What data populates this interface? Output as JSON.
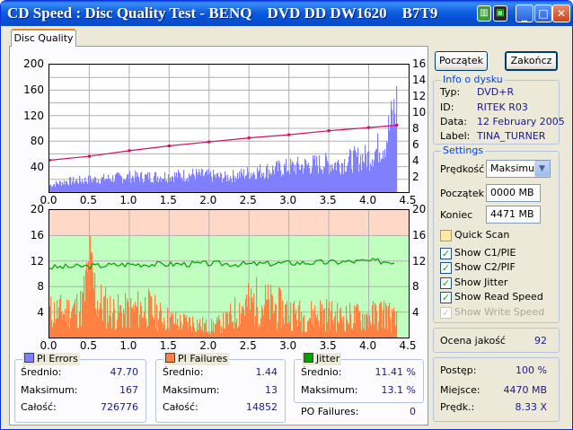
{
  "window": {
    "title": "CD Speed : Disc Quality Test - BENQ    DVD DD DW1620    B7T9",
    "icons": [
      "app-icon-1",
      "app-icon-2",
      "minimize-icon",
      "maximize-icon",
      "close-icon"
    ]
  },
  "tab": {
    "label": "Disc Quality"
  },
  "top_chart_axes": {
    "left_ticks": [
      "200",
      "160",
      "120",
      "80",
      "40"
    ],
    "right_ticks": [
      "16",
      "14",
      "12",
      "10",
      "8",
      "6",
      "4",
      "2"
    ],
    "x_ticks": [
      "0.0",
      "0.5",
      "1.0",
      "1.5",
      "2.0",
      "2.5",
      "3.0",
      "3.5",
      "4.0",
      "4.5"
    ]
  },
  "bottom_chart_axes": {
    "left_ticks": [
      "20",
      "16",
      "12",
      "8",
      "4"
    ],
    "right_ticks": [
      "20",
      "16",
      "12",
      "8",
      "4"
    ],
    "x_ticks": [
      "0.0",
      "0.5",
      "1.0",
      "1.5",
      "2.0",
      "2.5",
      "3.0",
      "3.5",
      "4.0",
      "4.5"
    ]
  },
  "chart_data": [
    {
      "type": "bar",
      "series": [
        {
          "name": "PI Errors",
          "color": "#8080ff",
          "x": [
            0.0,
            0.2,
            0.4,
            0.6,
            0.8,
            1.0,
            1.2,
            1.4,
            1.6,
            1.8,
            2.0,
            2.2,
            2.4,
            2.6,
            2.8,
            3.0,
            3.2,
            3.4,
            3.6,
            3.8,
            4.0,
            4.2,
            4.35
          ],
          "values": [
            12,
            18,
            20,
            22,
            24,
            26,
            26,
            27,
            28,
            30,
            28,
            25,
            30,
            35,
            38,
            42,
            45,
            48,
            48,
            55,
            60,
            85,
            150
          ]
        },
        {
          "name": "Read Speed",
          "color": "#d01060",
          "x": [
            0.0,
            0.5,
            1.0,
            1.5,
            2.0,
            2.5,
            3.0,
            3.5,
            4.0,
            4.35
          ],
          "values": [
            4.0,
            4.5,
            5.2,
            5.8,
            6.3,
            6.8,
            7.2,
            7.7,
            8.1,
            8.4
          ]
        }
      ],
      "xlim": [
        0,
        4.5
      ],
      "ylim": [
        0,
        200
      ],
      "y2lim": [
        0,
        16
      ]
    },
    {
      "type": "bar",
      "series": [
        {
          "name": "PI Failures",
          "color": "#ff8040",
          "x": [
            0.0,
            0.2,
            0.4,
            0.5,
            0.6,
            0.8,
            1.0,
            1.2,
            1.4,
            1.6,
            1.8,
            2.0,
            2.2,
            2.4,
            2.6,
            2.8,
            3.0,
            3.2,
            3.4,
            3.6,
            3.8,
            4.0,
            4.2,
            4.35
          ],
          "values": [
            5,
            5,
            6,
            13,
            7,
            5,
            5,
            6,
            4,
            3,
            3,
            2,
            3,
            6,
            7,
            6,
            5,
            4,
            5,
            4,
            4,
            4,
            5,
            3
          ]
        },
        {
          "name": "Jitter",
          "color": "#00a000",
          "x": [
            0.0,
            0.5,
            1.0,
            1.5,
            2.0,
            2.5,
            3.0,
            3.5,
            4.0,
            4.35
          ],
          "values": [
            11.0,
            11.2,
            11.5,
            11.5,
            11.6,
            11.5,
            11.7,
            11.8,
            12.0,
            11.9
          ]
        }
      ],
      "xlim": [
        0,
        4.5
      ],
      "ylim": [
        0,
        20
      ],
      "y2lim": [
        0,
        20
      ]
    }
  ],
  "pi_errors": {
    "title": "PI Errors",
    "color": "#8080ff",
    "avg_label": "Średnio:",
    "avg": "47.70",
    "max_label": "Maksimum:",
    "max": "167",
    "total_label": "Całość:",
    "total": "726776"
  },
  "pi_failures": {
    "title": "PI Failures",
    "color": "#ff8040",
    "avg_label": "Średnio:",
    "avg": "1.44",
    "max_label": "Maksimum:",
    "max": "13",
    "total_label": "Całość:",
    "total": "14852"
  },
  "jitter": {
    "title": "Jitter",
    "color": "#00a000",
    "avg_label": "Średnio:",
    "avg": "11.41 %",
    "max_label": "Maksimum:",
    "max": "13.1 %"
  },
  "po_failures": {
    "label": "PO Failures:",
    "value": "0"
  },
  "buttons": {
    "start": "Początek",
    "stop": "Zakończ"
  },
  "disc_info": {
    "title": "Info o dysku",
    "type_label": "Typ:",
    "type": "DVD+R",
    "id_label": "ID:",
    "id": "RITEK R03",
    "date_label": "Data:",
    "date": "12 February 2005",
    "label_label": "Label:",
    "label": "TINA_TURNER"
  },
  "settings": {
    "title": "Settings",
    "speed_label": "Prędkość",
    "speed": "Maksimum",
    "start_label": "Początek",
    "start": "0000 MB",
    "end_label": "Koniec",
    "end": "4471 MB",
    "quick_scan": "Quick Scan",
    "show_c1": "Show C1/PIE",
    "show_c2": "Show C2/PIF",
    "show_jitter": "Show Jitter",
    "show_read": "Show Read Speed",
    "show_write": "Show Write Speed"
  },
  "quality": {
    "label": "Ocena jakość",
    "value": "92"
  },
  "progress": {
    "label": "Postęp:",
    "value": "100 %",
    "position_label": "Miejsce:",
    "position": "4470 MB",
    "speed_label": "Prędk.:",
    "speed": "8.33 X"
  }
}
